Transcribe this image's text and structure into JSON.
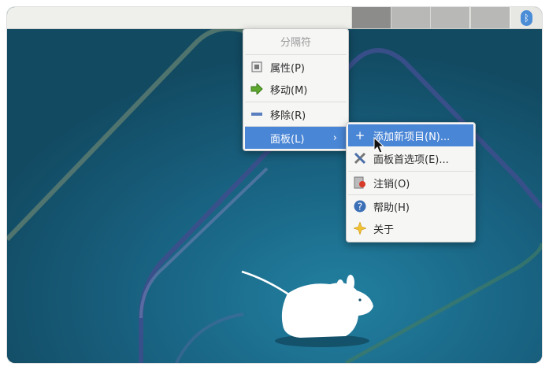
{
  "panel": {
    "workspaces": [
      "",
      "",
      "",
      ""
    ],
    "tray_icon": "bluetooth-icon"
  },
  "context_menu": {
    "title": "分隔符",
    "items": [
      {
        "label": "属性(P)",
        "icon": "properties-icon"
      },
      {
        "label": "移动(M)",
        "icon": "move-arrow-icon"
      },
      {
        "label": "移除(R)",
        "icon": "remove-icon"
      },
      {
        "label": "面板(L)",
        "icon": "",
        "submenu": true
      }
    ]
  },
  "submenu": {
    "items": [
      {
        "label": "添加新项目(N)...",
        "icon": "plus-icon"
      },
      {
        "label": "面板首选项(E)...",
        "icon": "tools-icon"
      },
      {
        "label": "注销(O)",
        "icon": "logout-icon"
      },
      {
        "label": "帮助(H)",
        "icon": "help-icon"
      },
      {
        "label": "关于",
        "icon": "about-star-icon"
      }
    ]
  },
  "colors": {
    "desktop_bg": "#16506a",
    "highlight": "#4a86d6",
    "menu_bg": "#f6f6f5"
  }
}
